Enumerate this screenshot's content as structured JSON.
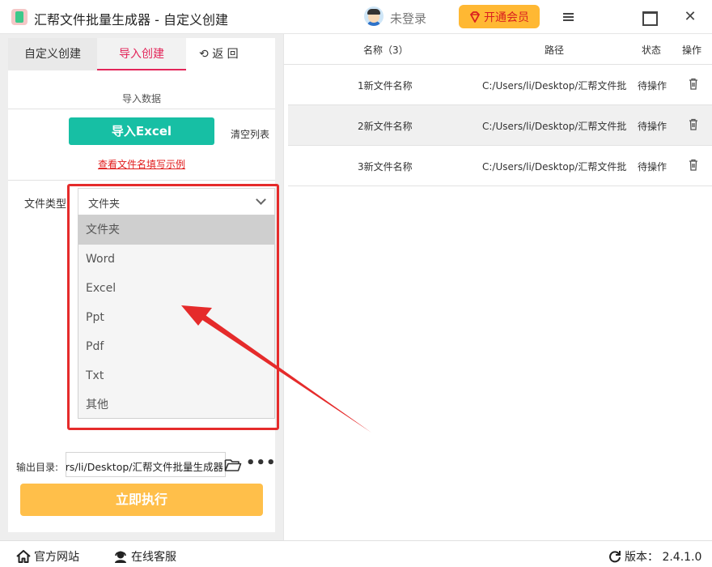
{
  "window": {
    "title": "汇帮文件批量生成器 - 自定义创建",
    "login_status": "未登录",
    "vip_button": "开通会员"
  },
  "left": {
    "tabs": [
      {
        "label": "自定义创建"
      },
      {
        "label": "导入创建"
      },
      {
        "label": "返 回"
      }
    ],
    "section_label": "导入数据",
    "import_excel_label": "导入Excel",
    "clear_list_label": "清空列表",
    "example_link": "查看文件名填写示例",
    "file_type_label": "文件类型",
    "file_type_value": "文件夹",
    "file_type_options": [
      "文件夹",
      "Word",
      "Excel",
      "Ppt",
      "Pdf",
      "Txt",
      "其他"
    ],
    "output_label": "输出目录:",
    "output_value": "rs/li/Desktop/汇帮文件批量生成器",
    "run_button": "立即执行"
  },
  "table": {
    "headers": {
      "name": "名称（3）",
      "path": "路径",
      "status": "状态",
      "action": "操作"
    },
    "rows": [
      {
        "name": "1新文件名称",
        "path": "C:/Users/li/Desktop/汇帮文件批",
        "status": "待操作"
      },
      {
        "name": "2新文件名称",
        "path": "C:/Users/li/Desktop/汇帮文件批",
        "status": "待操作"
      },
      {
        "name": "3新文件名称",
        "path": "C:/Users/li/Desktop/汇帮文件批",
        "status": "待操作"
      }
    ]
  },
  "footer": {
    "website": "官方网站",
    "support": "在线客服",
    "version": "版本：  2.4.1.0"
  },
  "colors": {
    "accent": "#e3265a",
    "teal": "#17bfa4",
    "orange": "#ffbf4a",
    "annotation_red": "#e52b2b"
  }
}
